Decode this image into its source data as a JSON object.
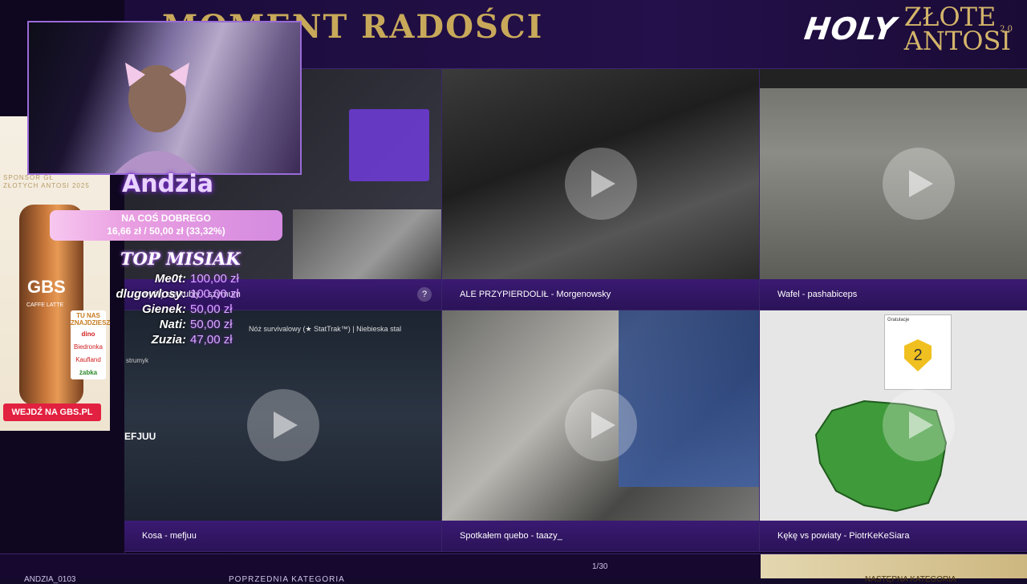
{
  "header": {
    "title": "MOMENT RADOŚCI",
    "logo_holy": "HOLY",
    "logo_line1": "ZŁOTE",
    "logo_line2": "ANTOSI",
    "logo_year": "2.0"
  },
  "tiles": [
    {
      "caption": "wyślij się kubły - szymum",
      "has_help": true
    },
    {
      "caption": "ALE PRZYPIERDOLIŁ - Morgenowsky"
    },
    {
      "caption": "Wafel - pashabiceps"
    },
    {
      "caption": "Kosa - mefjuu"
    },
    {
      "caption": "Spotkałem quebo - taazy_"
    },
    {
      "caption": "Kękę vs powiaty - PiotrKeKeSiara"
    }
  ],
  "help_label": "?",
  "tile_texts": {
    "knife_title": "Nóż survivalowy (★ StatTrak™) | Niebieska stal",
    "streamer_tag": "strumyk",
    "efjuu_tag": "EFJUU",
    "badge_number": "2",
    "badge_head": "Gratulacje"
  },
  "footer": {
    "user": "ANDZIA_0103",
    "prev": "POPRZEDNIA KATEGORIA",
    "pager": "1/30",
    "next": "NASTĘPNA KATEGORIA"
  },
  "overlay": {
    "streamer_name": "Andzia",
    "goal_title": "NA COŚ DOBREGO",
    "goal_amount": "16,66 zł  /  50,00 zł (33,32%)",
    "goal_progress": 0.3332,
    "top_title": "TOP MISIAK",
    "top_list": [
      {
        "name": "Me0t:",
        "value": "100,00 zł"
      },
      {
        "name": "dlugowlosy:",
        "value": "100,00 zł"
      },
      {
        "name": "Gienek:",
        "value": "50,00 zł"
      },
      {
        "name": "Nati:",
        "value": "50,00 zł"
      },
      {
        "name": "Zuzia:",
        "value": "47,00 zł"
      }
    ]
  },
  "sponsor": {
    "text_line1": "SPONSOR GŁ",
    "text_line2": "ZŁOTYCH ANTOSI 2025",
    "can_brand": "GBS",
    "can_sub": "CAFFE LATTE",
    "stores_head": "TU NAS ZNAJDZIESZ",
    "stores": [
      "dino",
      "Biedronka",
      "Kaufland",
      "żabka"
    ],
    "cta": "WEJDŹ NA GBS.PL"
  },
  "colors": {
    "gold": "#c8a95a",
    "purple_dark": "#140a2a",
    "caption_purple": "#3a1a72",
    "goal_pink": "#e99ee1"
  }
}
